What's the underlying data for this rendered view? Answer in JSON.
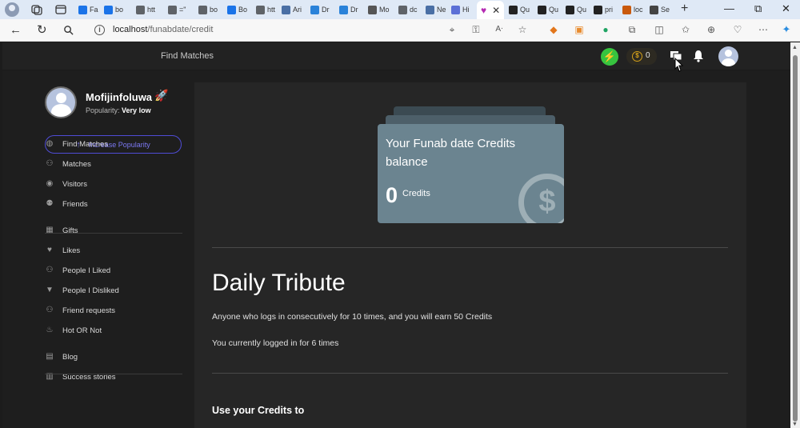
{
  "browser": {
    "tabs": [
      {
        "label": "Fa",
        "icon": "blue-page-icon",
        "color": "#1a73e8"
      },
      {
        "label": "bo",
        "icon": "bing-icon",
        "color": "#1a73e8"
      },
      {
        "label": "htt",
        "icon": "page-icon",
        "color": "#5f6368"
      },
      {
        "label": "=\"",
        "icon": "page-icon",
        "color": "#5f6368"
      },
      {
        "label": "bo",
        "icon": "page-icon",
        "color": "#5f6368"
      },
      {
        "label": "Bo",
        "icon": "bing-icon",
        "color": "#1a73e8"
      },
      {
        "label": "htt",
        "icon": "page-icon",
        "color": "#5f6368"
      },
      {
        "label": "Ari",
        "icon": "doc-icon",
        "color": "#4a6fa5"
      },
      {
        "label": "Dr",
        "icon": "edge-icon",
        "color": "#2a82d9"
      },
      {
        "label": "Dr",
        "icon": "edge-icon",
        "color": "#2a82d9"
      },
      {
        "label": "Mo",
        "icon": "globe-icon",
        "color": "#555"
      },
      {
        "label": "dc",
        "icon": "page-icon",
        "color": "#5f6368"
      },
      {
        "label": "Ne",
        "icon": "grid-icon",
        "color": "#4a6fa5"
      },
      {
        "label": "Hi",
        "icon": "shield-icon",
        "color": "#5b6fd6"
      }
    ],
    "active_tab": {
      "icon": "heart-icon",
      "color": "#b52bb3"
    },
    "tabs_right": [
      {
        "label": "Qu",
        "icon": "qu-icon",
        "color": "#222"
      },
      {
        "label": "Qu",
        "icon": "qu-icon",
        "color": "#222"
      },
      {
        "label": "Qu",
        "icon": "qu-icon",
        "color": "#222"
      },
      {
        "label": "pri",
        "icon": "lock-icon",
        "color": "#222"
      },
      {
        "label": "loc",
        "icon": "warning-icon",
        "color": "#c9590c"
      },
      {
        "label": "Se",
        "icon": "gear-icon",
        "color": "#444"
      }
    ],
    "url_host": "localhost",
    "url_path": "/funabdate/credit"
  },
  "topnav": {
    "title": "Find Matches",
    "coins": "0"
  },
  "profile": {
    "name": "Mofijinfoluwa",
    "popularity_label": "Popularity:",
    "popularity_value": "Very low",
    "boost_button": "Increase Popularity"
  },
  "menu": {
    "group1": [
      {
        "label": "Find Matches",
        "icon": "globe-icon"
      },
      {
        "label": "Matches",
        "icon": "people-icon"
      },
      {
        "label": "Visitors",
        "icon": "eye-icon"
      },
      {
        "label": "Friends",
        "icon": "friends-icon"
      }
    ],
    "group2": [
      {
        "label": "Gifts",
        "icon": "gift-icon"
      },
      {
        "label": "Likes",
        "icon": "heart-icon"
      },
      {
        "label": "People I Liked",
        "icon": "person-add-icon"
      },
      {
        "label": "People I Disliked",
        "icon": "thumbs-down-icon"
      },
      {
        "label": "Friend requests",
        "icon": "person-add-icon"
      },
      {
        "label": "Hot OR Not",
        "icon": "flame-icon"
      }
    ],
    "group3": [
      {
        "label": "Blog",
        "icon": "blog-icon"
      },
      {
        "label": "Success stories",
        "icon": "stories-icon"
      }
    ]
  },
  "credits_card": {
    "title": "Your Funab date Credits balance",
    "amount": "0",
    "unit": "Credits"
  },
  "daily": {
    "heading": "Daily Tribute",
    "line1": "Anyone who logs in consecutively for 10 times, and you will earn 50 Credits",
    "line2": "You currently logged in for 6 times"
  },
  "use_credits_heading": "Use your Credits to",
  "colors": {
    "accent": "#4f4cd6",
    "card": "#6b8490",
    "boost": "#37c43f",
    "coin": "#d4a01a"
  }
}
